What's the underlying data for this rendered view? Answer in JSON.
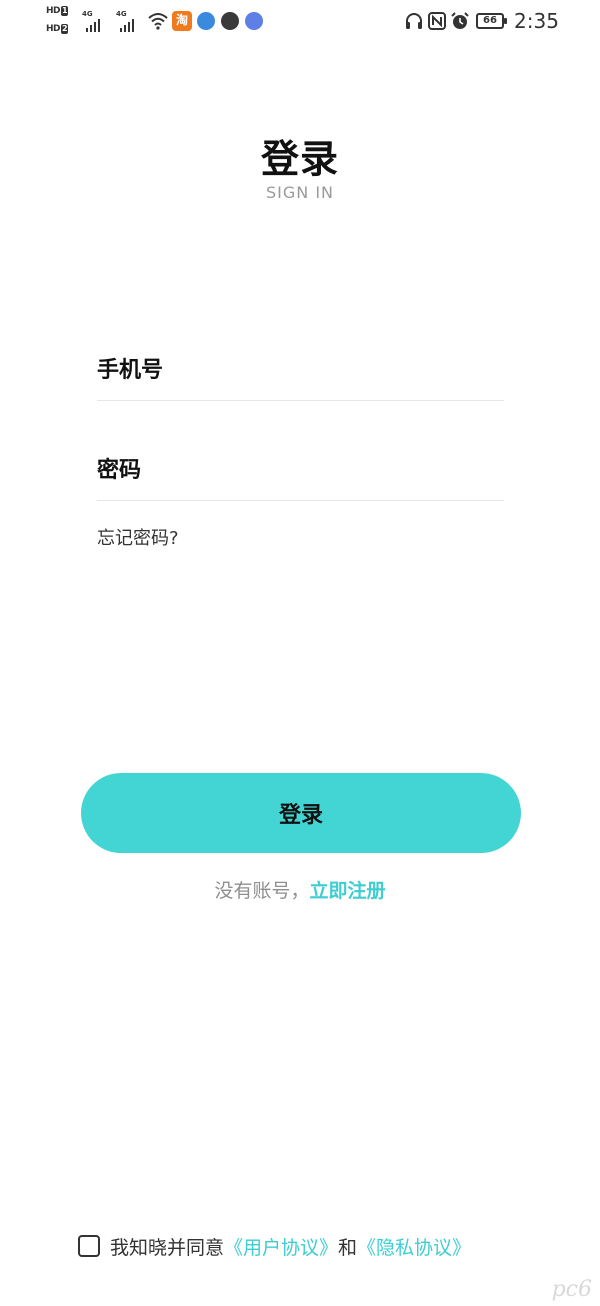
{
  "status_bar": {
    "time": "2:35",
    "battery": "66",
    "sim1_label": "HD",
    "sim1_index": "1",
    "sim2_label": "HD",
    "sim2_index": "2",
    "network1": "4G",
    "network2": "4G",
    "taobao_glyph": "淘",
    "icons": [
      "headphones-icon",
      "nfc-icon",
      "alarm-icon",
      "wifi-icon"
    ]
  },
  "header": {
    "title": "登录",
    "subtitle": "SIGN IN"
  },
  "form": {
    "phone_placeholder": "手机号",
    "phone_value": "",
    "password_placeholder": "密码",
    "password_value": "",
    "forgot_label": "忘记密码?"
  },
  "actions": {
    "login_label": "登录",
    "no_account_text": "没有账号，",
    "register_label": "立即注册"
  },
  "agreement": {
    "prefix": "我知晓并同意",
    "user_agreement": "《用户协议》",
    "conjunction": "和",
    "privacy_agreement": "《隐私协议》"
  },
  "colors": {
    "accent": "#42d5d4",
    "link": "#3ecdd0",
    "muted": "#9a9a9a"
  }
}
